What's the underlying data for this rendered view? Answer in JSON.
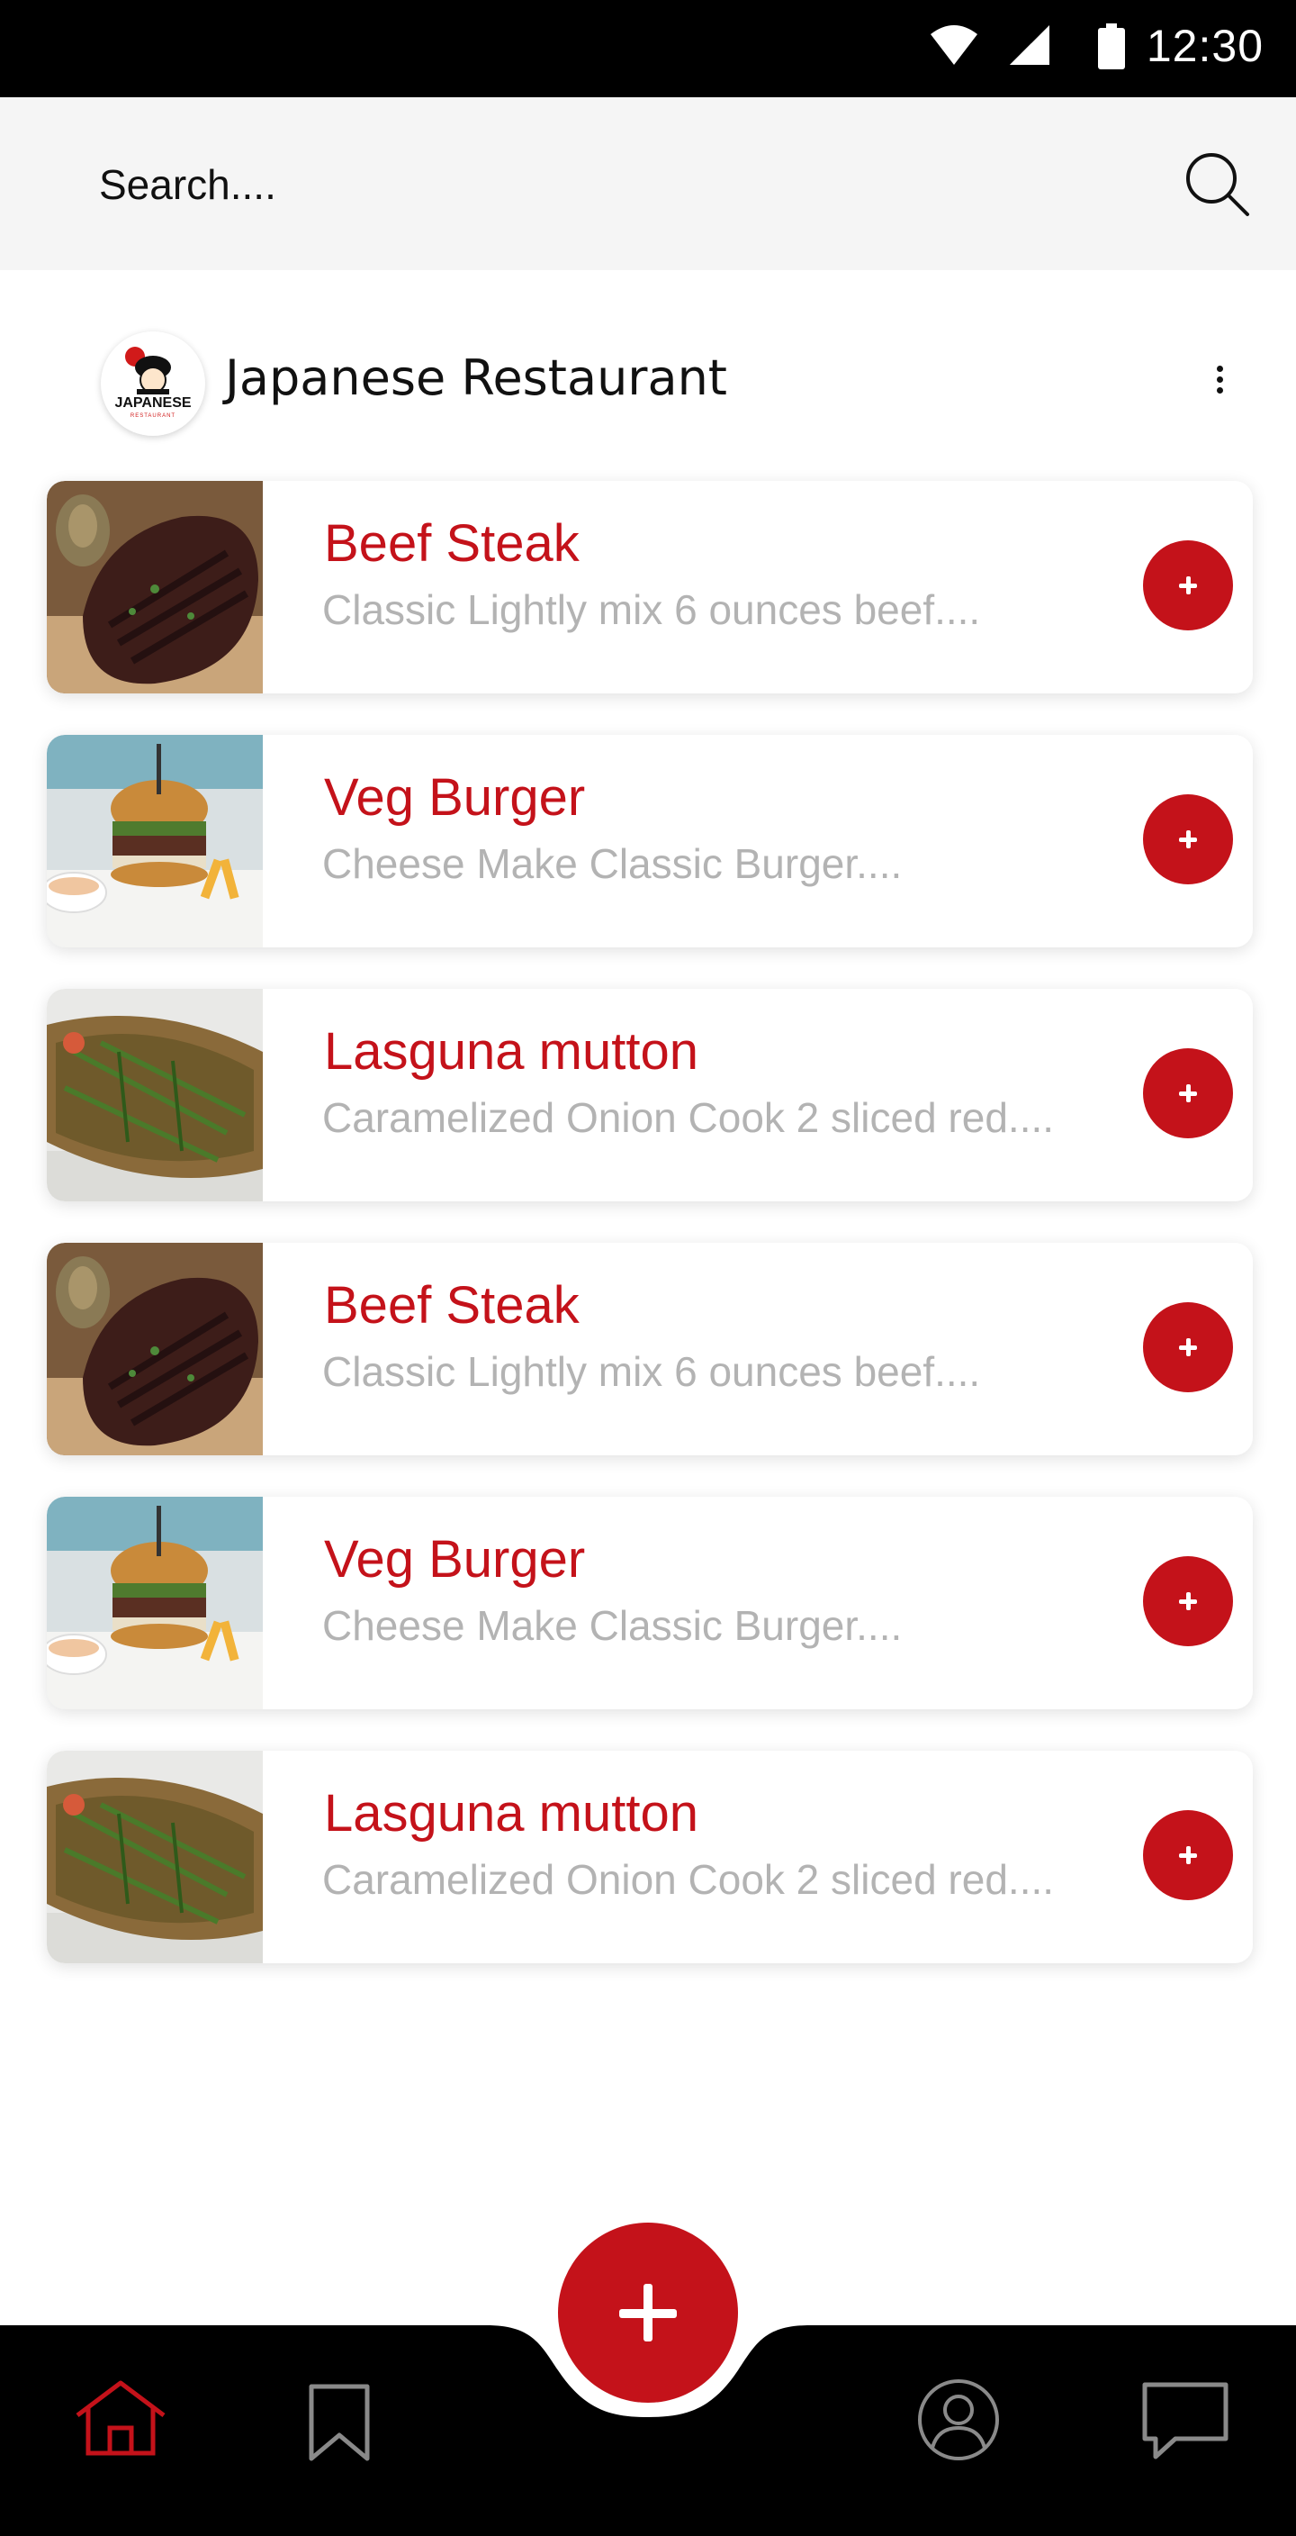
{
  "status_bar": {
    "time": "12:30",
    "icons": [
      "wifi-icon",
      "signal-icon",
      "battery-icon"
    ]
  },
  "search": {
    "placeholder": "Search....",
    "icon": "search-icon"
  },
  "restaurant": {
    "logo_text": "JAPANESE",
    "logo_subtext": "RESTAURANT",
    "name": "Japanese Restaurant",
    "menu_icon": "more-vertical-icon"
  },
  "menu_items": [
    {
      "title": "Beef Steak",
      "description": "Classic Lightly mix 6 ounces  beef....",
      "image": "steak"
    },
    {
      "title": "Veg Burger",
      "description": "Cheese Make Classic Burger....",
      "image": "burger"
    },
    {
      "title": "Lasguna mutton",
      "description": "Caramelized Onion Cook 2 sliced red....",
      "image": "mutton"
    },
    {
      "title": "Beef Steak",
      "description": "Classic Lightly mix 6 ounces beef....",
      "image": "steak"
    },
    {
      "title": "Veg Burger",
      "description": "Cheese Make Classic Burger....",
      "image": "burger"
    },
    {
      "title": "Lasguna mutton",
      "description": "Caramelized Onion Cook 2 sliced red....",
      "image": "mutton"
    }
  ],
  "bottom_nav": {
    "items": [
      "home-icon",
      "bookmark-icon",
      "profile-icon",
      "chat-icon"
    ],
    "active": "home-icon",
    "fab_icon": "plus-icon"
  },
  "colors": {
    "accent": "#c4121a",
    "status_bar": "#000000",
    "nav_background": "#000000",
    "search_background": "#f5f5f5",
    "title_text": "#c4121a",
    "description_text": "#b3b3b3"
  }
}
